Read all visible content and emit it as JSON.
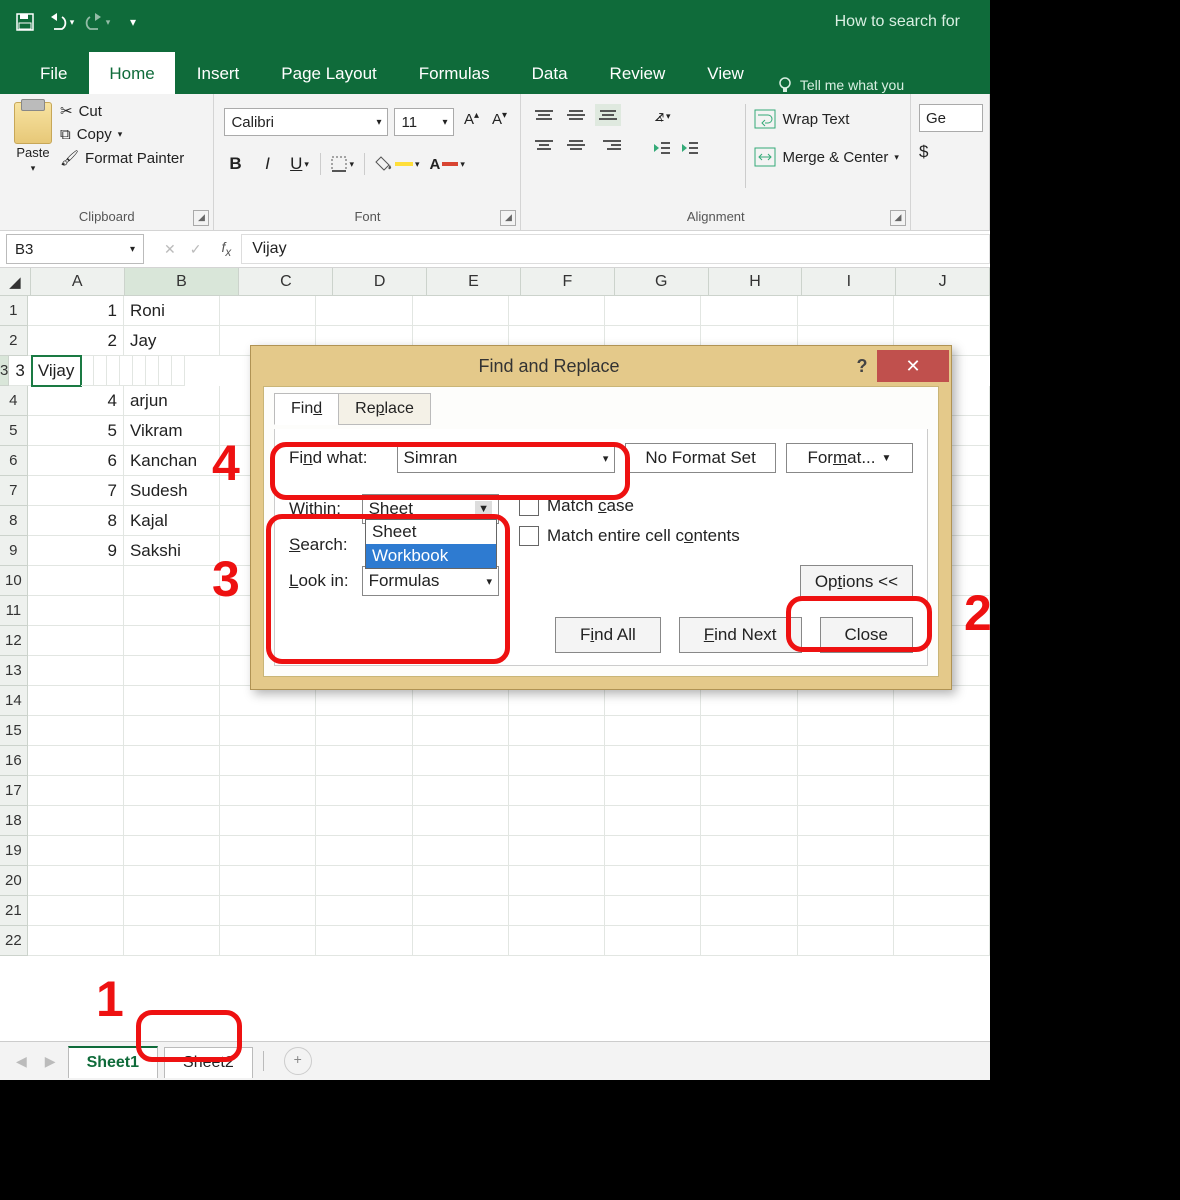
{
  "window_title": "How to search for",
  "ribbon_tabs": [
    "File",
    "Home",
    "Insert",
    "Page Layout",
    "Formulas",
    "Data",
    "Review",
    "View"
  ],
  "active_tab": "Home",
  "tellme": "Tell me what you",
  "clipboard": {
    "paste": "Paste",
    "cut": "Cut",
    "copy": "Copy",
    "painter": "Format Painter",
    "group": "Clipboard"
  },
  "font": {
    "name": "Calibri",
    "size": "11",
    "group": "Font"
  },
  "alignment": {
    "wrap": "Wrap Text",
    "merge": "Merge & Center",
    "group": "Alignment"
  },
  "number": {
    "value": "Ge",
    "currency": "$"
  },
  "namebox": "B3",
  "formula_value": "Vijay",
  "columns": [
    "A",
    "B",
    "C",
    "D",
    "E",
    "F",
    "G",
    "H",
    "I",
    "J"
  ],
  "rows": [
    {
      "n": "1",
      "a": "1",
      "b": "Roni"
    },
    {
      "n": "2",
      "a": "2",
      "b": "Jay"
    },
    {
      "n": "3",
      "a": "3",
      "b": "Vijay"
    },
    {
      "n": "4",
      "a": "4",
      "b": "arjun"
    },
    {
      "n": "5",
      "a": "5",
      "b": "Vikram"
    },
    {
      "n": "6",
      "a": "6",
      "b": "Kanchan"
    },
    {
      "n": "7",
      "a": "7",
      "b": "Sudesh"
    },
    {
      "n": "8",
      "a": "8",
      "b": "Kajal"
    },
    {
      "n": "9",
      "a": "9",
      "b": "Sakshi"
    }
  ],
  "blank_rows": [
    "10",
    "11",
    "12",
    "13",
    "14",
    "15",
    "16",
    "17",
    "18",
    "19",
    "20",
    "21",
    "22"
  ],
  "sheets": {
    "s1": "Sheet1",
    "s2": "Sheet2"
  },
  "dialog": {
    "title": "Find and Replace",
    "tab_find": "Find",
    "tab_replace": "Replace",
    "find_what_label": "Find what:",
    "find_what_value": "Simran",
    "no_format": "No Format Set",
    "format": "Format...",
    "within_label": "Within:",
    "within_value": "Sheet",
    "within_opts": {
      "o1": "Sheet",
      "o2": "Workbook"
    },
    "search_label": "Search:",
    "lookin_label": "Look in:",
    "lookin_value": "Formulas",
    "match_case": "Match case",
    "match_entire": "Match entire cell contents",
    "options": "Options <<",
    "find_all": "Find All",
    "find_next": "Find Next",
    "close": "Close"
  },
  "annot": {
    "n1": "1",
    "n2": "2",
    "n3": "3",
    "n4": "4"
  }
}
